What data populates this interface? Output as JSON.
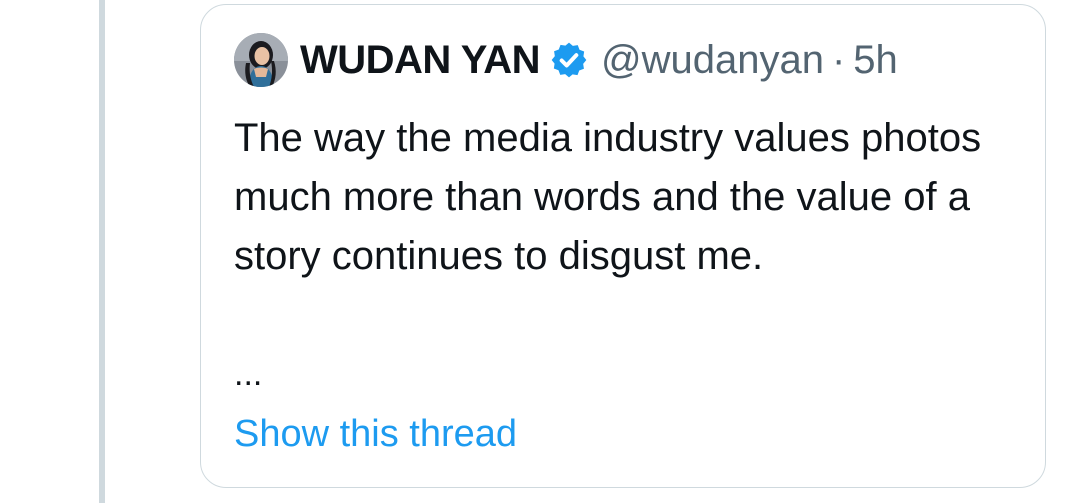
{
  "quoted_tweet": {
    "author": {
      "name": "WUDAN YAN",
      "handle": "@wudanyan",
      "verified": true
    },
    "separator": "·",
    "timestamp": "5h",
    "text": "The way the media industry values photos much more than words and the value of a story continues to disgust me.",
    "truncation": "...",
    "show_thread_label": "Show this thread"
  },
  "colors": {
    "text_primary": "#0f1419",
    "text_secondary": "#536471",
    "link": "#1d9bf0",
    "verified_badge": "#1d9bf0",
    "border": "#cfd9de",
    "thread_line": "#cfd9de"
  }
}
